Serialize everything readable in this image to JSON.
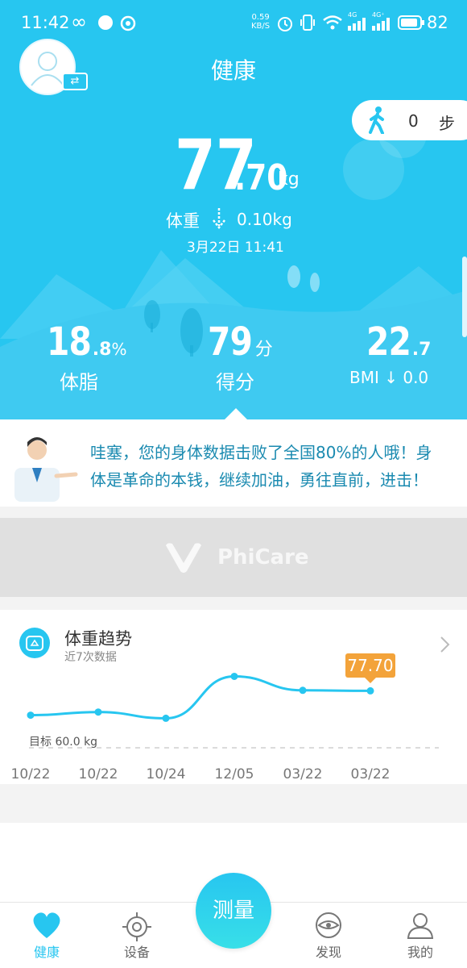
{
  "status_bar": {
    "time": "11:42",
    "net_speed_top": "0.59",
    "net_speed_bottom": "KB/S",
    "net_4g_a": "4G",
    "net_4g_b": "4G⁺",
    "battery": "82"
  },
  "header": {
    "title": "健康",
    "steps_value": "0",
    "steps_unit": "步"
  },
  "weight": {
    "integer": "77",
    "decimal": ".70",
    "unit": "kg",
    "change_label": "体重",
    "change_value": "0.10kg",
    "timestamp": "3月22日 11:41"
  },
  "stats": [
    {
      "big": "18",
      "small": ".8",
      "unit": "%",
      "label": "体脂"
    },
    {
      "big": "79",
      "small": "",
      "unit": "分",
      "label": "得分"
    },
    {
      "big": "22",
      "small": ".7",
      "unit": "",
      "label": "BMI ↓ 0.0"
    }
  ],
  "advice": {
    "line1": "哇塞，您的身体数据击败了全国80%的人哦！身",
    "line2": "体是革命的本钱，继续加油，勇往直前，进击！"
  },
  "banner": {
    "brand": "PhiCare"
  },
  "trend": {
    "title": "体重趋势",
    "subtitle": "近7次数据",
    "goal_label": "目标 60.0 kg",
    "latest_badge": "77.70"
  },
  "chart_data": {
    "type": "line",
    "categories": [
      "10/22",
      "10/22",
      "10/24",
      "12/05",
      "03/22",
      "03/22"
    ],
    "series": [
      {
        "values": [
          73.0,
          73.6,
          72.4,
          80.5,
          77.8,
          77.7
        ]
      }
    ],
    "ylim": [
      60,
      84
    ],
    "annotations": [
      "目标 60.0 kg",
      "77.70"
    ],
    "grid": false
  },
  "tabbar": {
    "items": [
      {
        "label": "健康",
        "icon": "heart-icon",
        "active": true
      },
      {
        "label": "设备",
        "icon": "target-icon",
        "active": false
      },
      {
        "label": "发现",
        "icon": "eye-icon",
        "active": false
      },
      {
        "label": "我的",
        "icon": "person-icon",
        "active": false
      }
    ],
    "measure_label": "测量"
  },
  "colors": {
    "primary": "#27c6f0",
    "badge": "#f3a33a",
    "teal_text": "#1a8ab0"
  }
}
